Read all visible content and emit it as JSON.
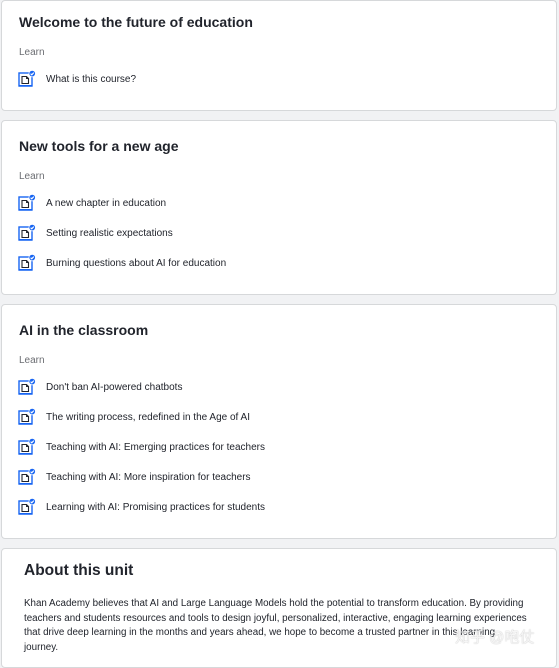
{
  "sections": [
    {
      "title": "Welcome to the future of education",
      "label": "Learn",
      "lessons": [
        "What is this course?"
      ]
    },
    {
      "title": "New tools for a new age",
      "label": "Learn",
      "lessons": [
        "A new chapter in education",
        "Setting realistic expectations",
        "Burning questions about AI for education"
      ]
    },
    {
      "title": "AI in the classroom",
      "label": "Learn",
      "lessons": [
        "Don't ban AI-powered chatbots",
        "The writing process, redefined in the Age of AI",
        "Teaching with AI: Emerging practices for teachers",
        "Teaching with AI: More inspiration for teachers",
        "Learning with AI: Promising practices for students"
      ]
    }
  ],
  "about": {
    "title": "About this unit",
    "body": "Khan Academy believes that AI and Large Language Models hold the potential to transform education. By providing teachers and students resources and tools to design joyful, personalized, interactive, engaging learning experiences that drive deep learning in the months and years ahead, we hope to become a trusted partner in this learning journey."
  },
  "watermark": "知乎 @咆仗",
  "colors": {
    "icon_blue": "#1865f2",
    "check_blue": "#1865f2",
    "border": "#d6d8da",
    "background": "#f1f2f4"
  },
  "icons": {
    "lesson": "article-check-icon"
  }
}
